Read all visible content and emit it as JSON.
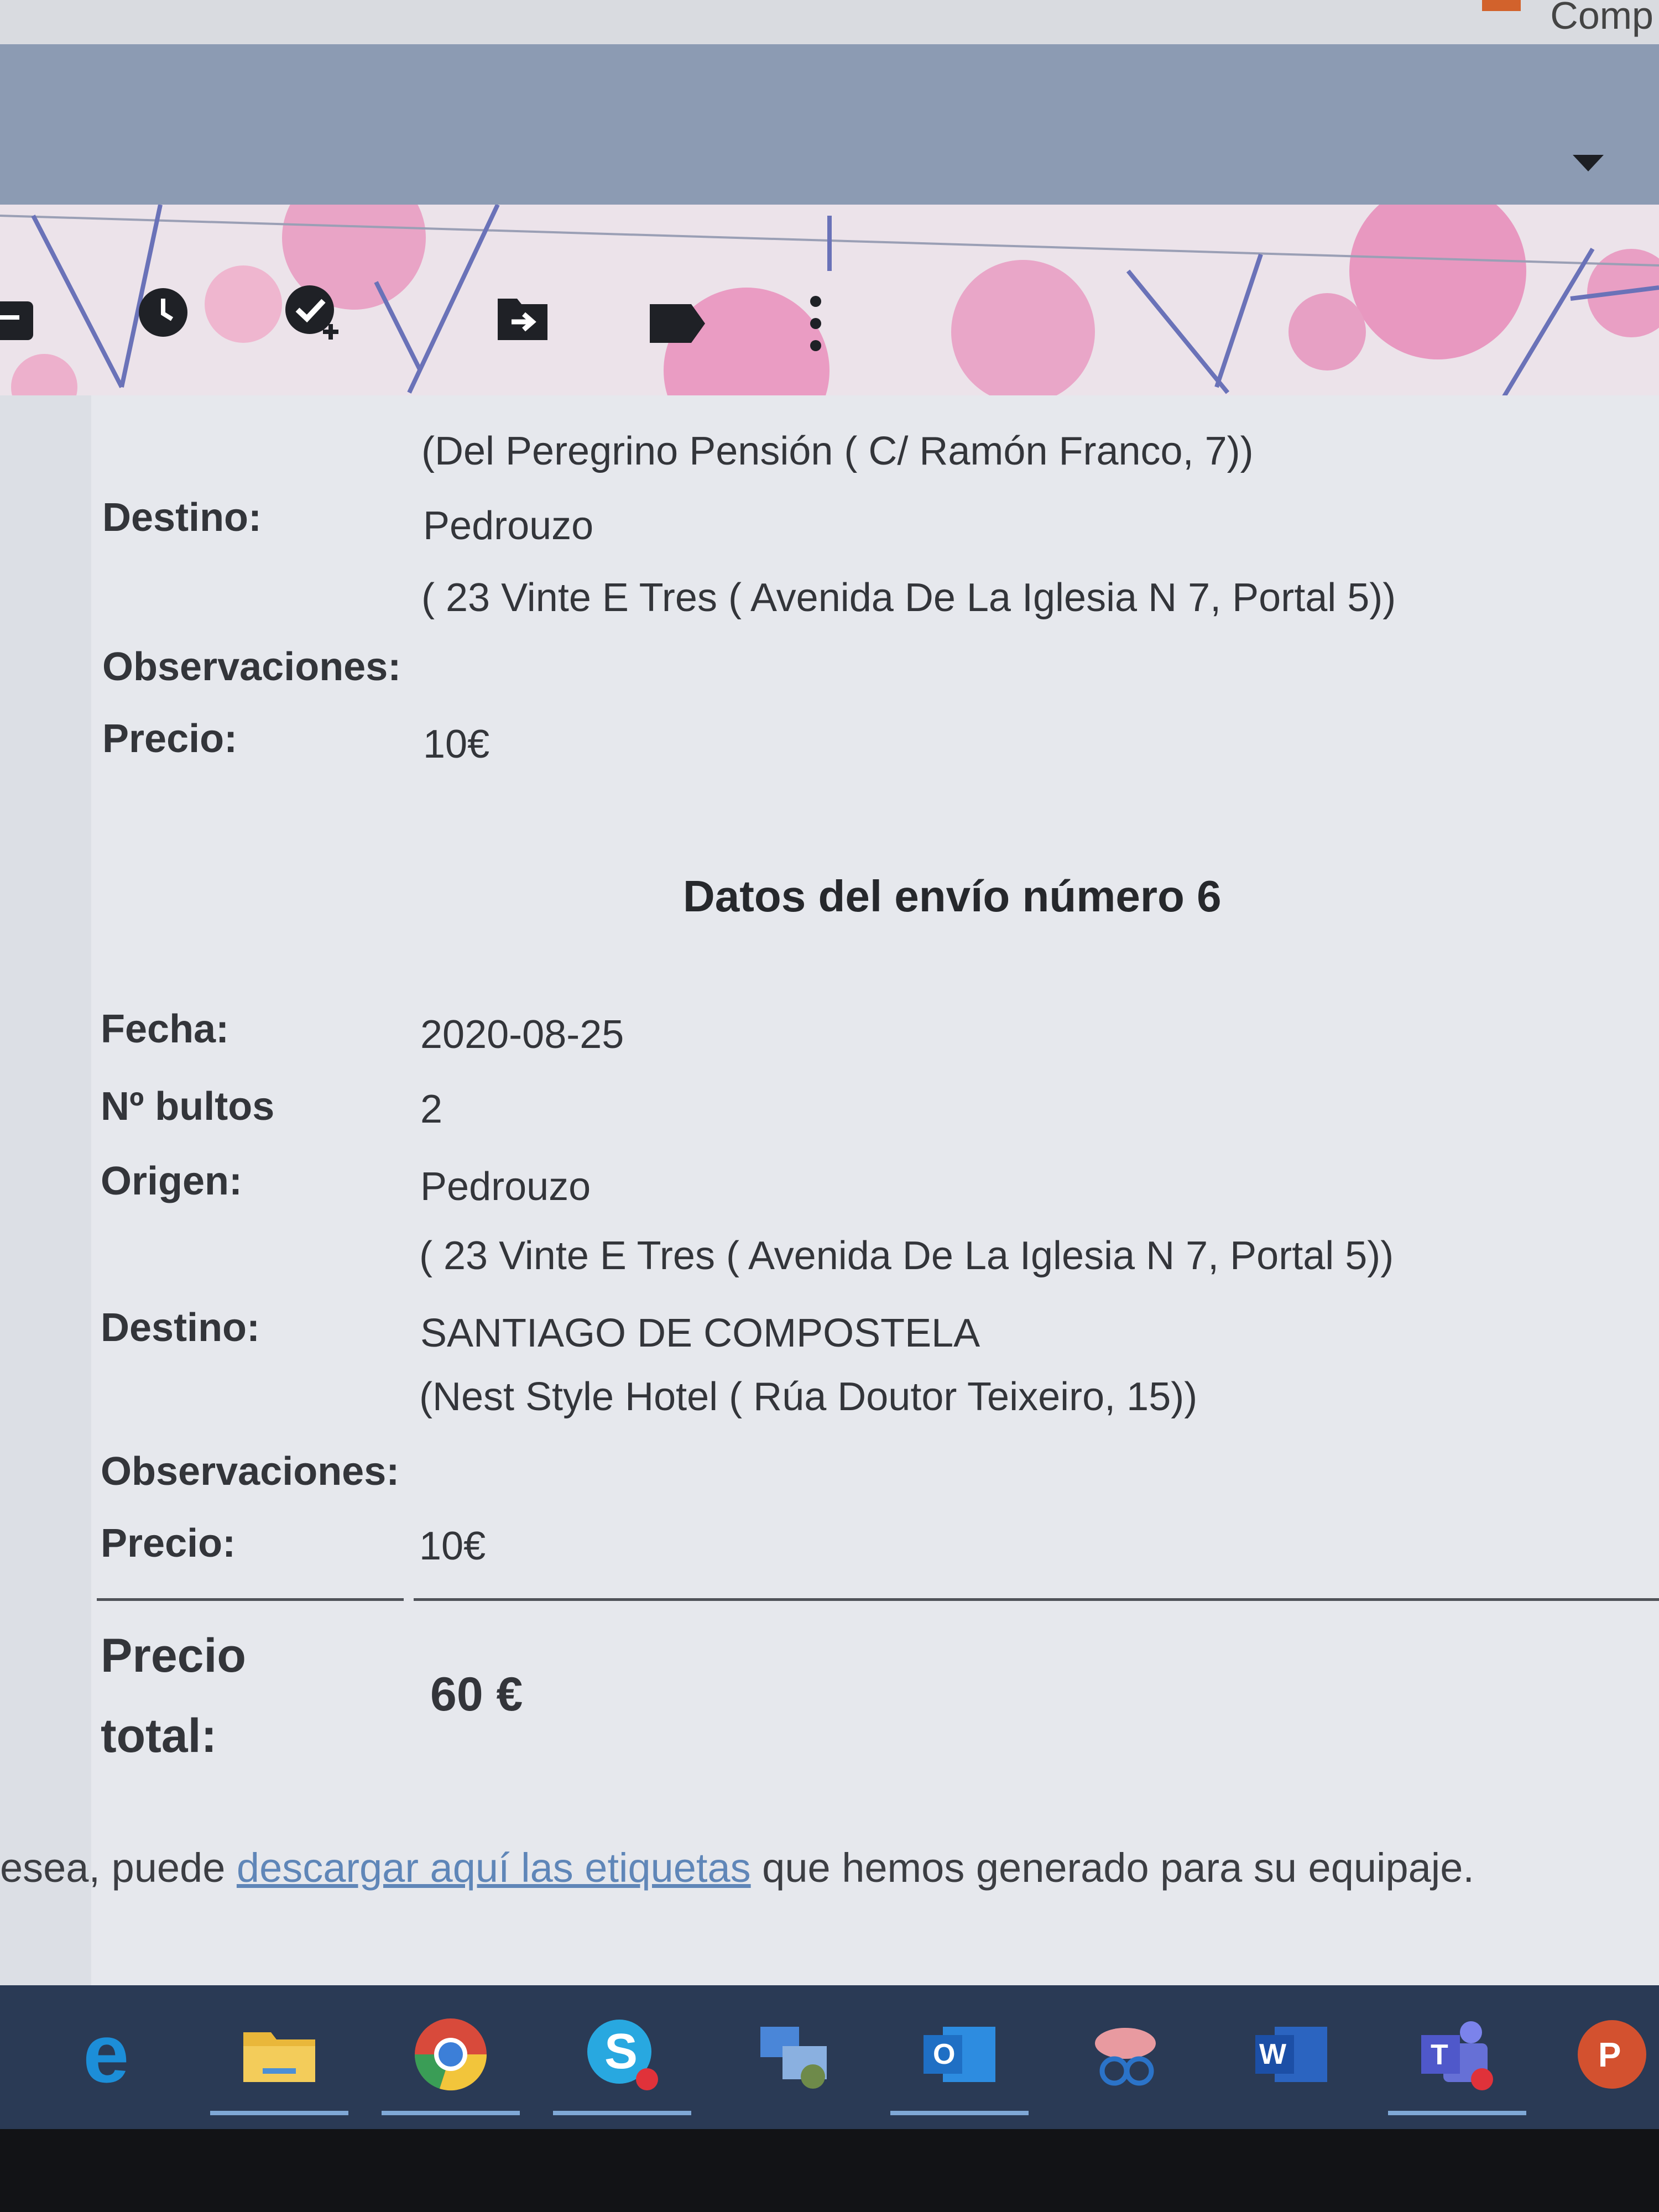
{
  "top_strip": {
    "label": "Comp"
  },
  "toolbar": {
    "icons": [
      "archive-icon",
      "clock-icon",
      "add-task-icon",
      "move-to-icon",
      "label-icon",
      "more-vert-icon"
    ]
  },
  "shipment5_tail": {
    "origin_detail": "(Del Peregrino Pensión ( C/ Ramón Franco, 7))",
    "destino_label": "Destino:",
    "destino_city": "Pedrouzo",
    "destino_detail": "( 23 Vinte E Tres ( Avenida De La Iglesia N 7, Portal 5))",
    "observaciones_label": "Observaciones:",
    "precio_label": "Precio:",
    "precio_value": "10€"
  },
  "shipment6": {
    "title": "Datos del envío número 6",
    "fecha_label": "Fecha:",
    "fecha_value": "2020-08-25",
    "bultos_label": "Nº bultos",
    "bultos_value": "2",
    "origen_label": "Origen:",
    "origen_city": "Pedrouzo",
    "origen_detail": "( 23 Vinte E Tres ( Avenida De La Iglesia N 7, Portal 5))",
    "destino_label": "Destino:",
    "destino_city": "SANTIAGO DE COMPOSTELA",
    "destino_detail": "(Nest Style Hotel ( Rúa Doutor Teixeiro, 15))",
    "observaciones_label": "Observaciones:",
    "precio_label": "Precio:",
    "precio_value": "10€"
  },
  "total": {
    "label_line1": "Precio",
    "label_line2": "total:",
    "value": "60 €"
  },
  "footer": {
    "before": "esea, puede ",
    "link": "descargar aquí las etiquetas",
    "after": " que hemos generado para su equipaje."
  },
  "taskbar": {
    "apps": [
      "edge-icon",
      "file-explorer-icon",
      "chrome-icon",
      "skype-icon",
      "network-icon",
      "outlook-icon",
      "snipping-tool-icon",
      "word-icon",
      "teams-icon",
      "powerpoint-icon"
    ]
  }
}
